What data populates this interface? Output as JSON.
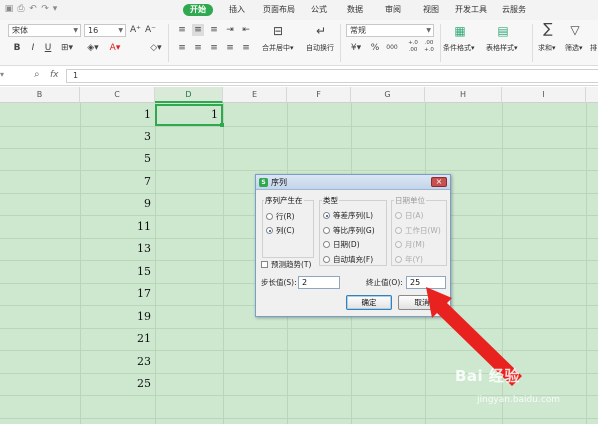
{
  "quick_access": {
    "icons": [
      "save-icon",
      "undo-icon",
      "redo-icon",
      "dropdown-icon"
    ]
  },
  "tabs": [
    {
      "label": "开始",
      "active": true
    },
    {
      "label": "插入"
    },
    {
      "label": "页面布局"
    },
    {
      "label": "公式"
    },
    {
      "label": "数据"
    },
    {
      "label": "审阅"
    },
    {
      "label": "视图"
    },
    {
      "label": "开发工具"
    },
    {
      "label": "云服务"
    }
  ],
  "ribbon": {
    "font_name": "宋体",
    "font_size": "16",
    "number_format": "常规",
    "merge_label": "合并居中",
    "wrap_label": "自动换行",
    "cond_format_label": "条件格式",
    "table_style_label": "表格样式",
    "sum_label": "求和",
    "filter_label": "筛选",
    "sort_label": "排",
    "bold": "B",
    "italic": "I",
    "underline": "U",
    "font_color": "A",
    "percent": "%",
    "currency": "¥",
    "thousands": "000",
    "dec_inc": "+.0\n.00",
    "dec_dec": ".00\n+.0",
    "sigma": "∑"
  },
  "formula_bar": {
    "fx": "fx",
    "value": "1"
  },
  "columns": [
    {
      "label": "B"
    },
    {
      "label": "C"
    },
    {
      "label": "D",
      "active": true
    },
    {
      "label": "E"
    },
    {
      "label": "F"
    },
    {
      "label": "G"
    },
    {
      "label": "H"
    },
    {
      "label": "I"
    }
  ],
  "cells_c": [
    "1",
    "3",
    "5",
    "7",
    "9",
    "11",
    "13",
    "15",
    "17",
    "19",
    "21",
    "23",
    "25"
  ],
  "cell_d1": "1",
  "dialog": {
    "title": "序列",
    "close": "×",
    "series_in": {
      "title": "序列产生在",
      "options": [
        "行(R)",
        "列(C)"
      ],
      "selected": 1
    },
    "type": {
      "title": "类型",
      "options": [
        "等差序列(L)",
        "等比序列(G)",
        "日期(D)",
        "自动填充(F)"
      ],
      "selected": 0
    },
    "date_unit": {
      "title": "日期单位",
      "options": [
        "日(A)",
        "工作日(W)",
        "月(M)",
        "年(Y)"
      ],
      "disabled": true
    },
    "trend_label": "预测趋势(T)",
    "step_label": "步长值(S):",
    "step_value": "2",
    "stop_label": "终止值(O):",
    "stop_value": "25",
    "ok_label": "确定",
    "cancel_label": "取消"
  },
  "watermark": {
    "line1": "Bai 经验",
    "line2": "jingyan.baidu.com"
  },
  "colors": {
    "accent": "#2fa84f",
    "sheet_bg": "#cde8cf",
    "arrow": "#e8231f"
  }
}
